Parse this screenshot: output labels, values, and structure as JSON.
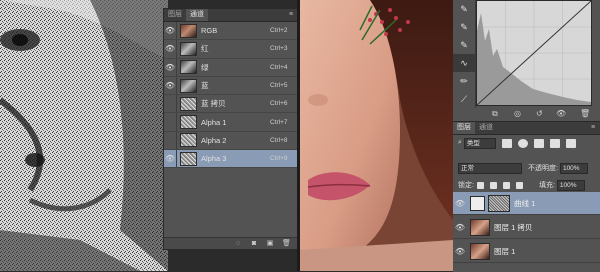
{
  "channels_panel": {
    "tabs": [
      {
        "label": "图层"
      },
      {
        "label": "通道"
      }
    ],
    "channels": [
      {
        "name": "RGB",
        "shortcut": "Ctrl+2",
        "thumb": "color"
      },
      {
        "name": "红",
        "shortcut": "Ctrl+3",
        "thumb": "gray"
      },
      {
        "name": "绿",
        "shortcut": "Ctrl+4",
        "thumb": "gray"
      },
      {
        "name": "蓝",
        "shortcut": "Ctrl+5",
        "thumb": "gray"
      },
      {
        "name": "蓝 拷贝",
        "shortcut": "Ctrl+6",
        "thumb": "noise"
      },
      {
        "name": "Alpha 1",
        "shortcut": "Ctrl+7",
        "thumb": "noise"
      },
      {
        "name": "Alpha 2",
        "shortcut": "Ctrl+8",
        "thumb": "noise"
      },
      {
        "name": "Alpha 3",
        "shortcut": "Ctrl+9",
        "thumb": "noise",
        "selected": true
      }
    ]
  },
  "layers_panel": {
    "tabs": [
      {
        "label": "图层"
      },
      {
        "label": "通道"
      }
    ],
    "kind_select": "类型",
    "blend_mode": "正常",
    "opacity_label": "不透明度:",
    "opacity_value": "100%",
    "lock_label": "锁定:",
    "fill_label": "填充:",
    "fill_value": "100%",
    "layers": [
      {
        "name": "曲线 1",
        "selected": true
      },
      {
        "name": "图层 1 拷贝"
      },
      {
        "name": "图层 1"
      }
    ]
  },
  "colors": {
    "selection": "#8a9bb5",
    "panel": "#535353"
  }
}
